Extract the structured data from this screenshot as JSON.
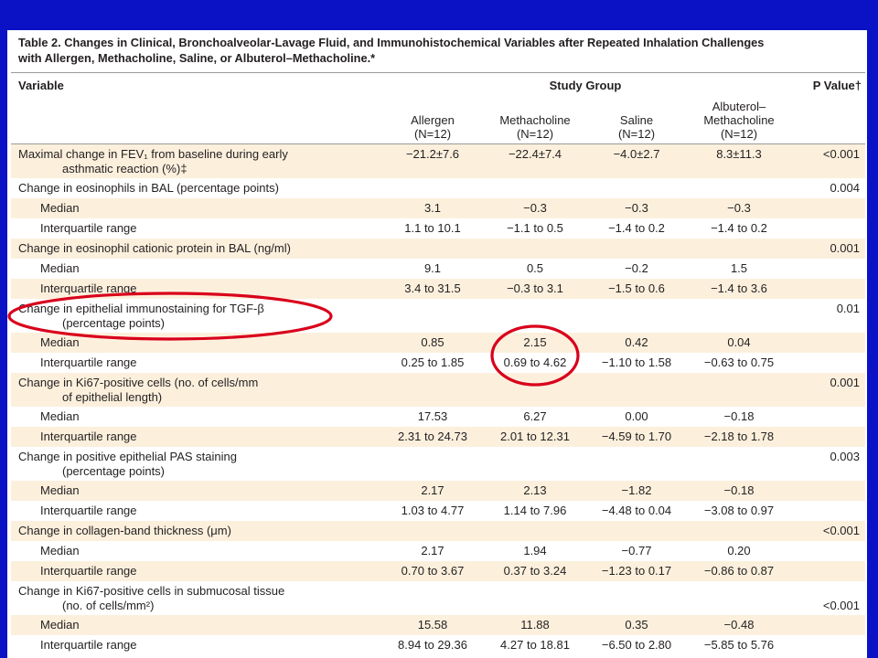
{
  "colors": {
    "slide_background": "#0b12c6",
    "panel": "#ffffff",
    "row_shade": "#fcf0dd",
    "text": "#231f20",
    "highlight": "#d9001b"
  },
  "table": {
    "title_lines": [
      "Table 2. Changes in Clinical, Bronchoalveolar-Lavage Fluid, and Immunohistochemical Variables after Repeated Inhalation Challenges",
      "with Allergen, Methacholine, Saline, or Albuterol–Methacholine.*"
    ],
    "header": {
      "variable": "Variable",
      "study_group": "Study Group",
      "p_value": "P Value†"
    },
    "groups": [
      {
        "name_lines": [
          "Allergen"
        ],
        "n": "(N=12)"
      },
      {
        "name_lines": [
          "Methacholine"
        ],
        "n": "(N=12)"
      },
      {
        "name_lines": [
          "Saline"
        ],
        "n": "(N=12)"
      },
      {
        "name_lines": [
          "Albuterol–",
          "Methacholine"
        ],
        "n": "(N=12)"
      }
    ],
    "rows": [
      {
        "label_lines": [
          "Maximal change in FEV₁ from baseline during early",
          "asthmatic reaction (%)‡"
        ],
        "values": [
          "−21.2±7.6",
          "−22.4±7.4",
          "−4.0±2.7",
          "8.3±11.3"
        ],
        "p_value": "<0.001"
      },
      {
        "label_lines": [
          "Change in eosinophils in BAL (percentage points)"
        ],
        "p_value": "0.004"
      },
      {
        "label_lines": [
          "Median"
        ],
        "values": [
          "3.1",
          "−0.3",
          "−0.3",
          "−0.3"
        ]
      },
      {
        "label_lines": [
          "Interquartile range"
        ],
        "values": [
          "1.1 to 10.1",
          "−1.1 to 0.5",
          "−1.4 to 0.2",
          "−1.4 to 0.2"
        ]
      },
      {
        "label_lines": [
          "Change in eosinophil cationic protein in BAL (ng/ml)"
        ],
        "p_value": "0.001"
      },
      {
        "label_lines": [
          "Median"
        ],
        "values": [
          "9.1",
          "0.5",
          "−0.2",
          "1.5"
        ]
      },
      {
        "label_lines": [
          "Interquartile range"
        ],
        "values": [
          "3.4 to 31.5",
          "−0.3 to 3.1",
          "−1.5 to 0.6",
          "−1.4 to 3.6"
        ]
      },
      {
        "label_lines": [
          "Change in epithelial immunostaining for TGF-β",
          "(percentage points)"
        ],
        "p_value": "0.01"
      },
      {
        "label_lines": [
          "Median"
        ],
        "values": [
          "0.85",
          "2.15",
          "0.42",
          "0.04"
        ]
      },
      {
        "label_lines": [
          "Interquartile range"
        ],
        "values": [
          "0.25 to 1.85",
          "0.69 to 4.62",
          "−1.10 to 1.58",
          "−0.63 to 0.75"
        ]
      },
      {
        "label_lines": [
          "Change in Ki67-positive cells (no. of cells/mm",
          "of epithelial length)"
        ],
        "p_value": "0.001"
      },
      {
        "label_lines": [
          "Median"
        ],
        "values": [
          "17.53",
          "6.27",
          "0.00",
          "−0.18"
        ]
      },
      {
        "label_lines": [
          "Interquartile range"
        ],
        "values": [
          "2.31 to 24.73",
          "2.01 to 12.31",
          "−4.59 to 1.70",
          "−2.18 to 1.78"
        ]
      },
      {
        "label_lines": [
          "Change in positive epithelial PAS staining",
          "(percentage points)"
        ],
        "p_value": "0.003"
      },
      {
        "label_lines": [
          "Median"
        ],
        "values": [
          "2.17",
          "2.13",
          "−1.82",
          "−0.18"
        ]
      },
      {
        "label_lines": [
          "Interquartile range"
        ],
        "values": [
          "1.03 to 4.77",
          "1.14 to 7.96",
          "−4.48 to 0.04",
          "−3.08 to 0.97"
        ]
      },
      {
        "label_lines": [
          "Change in collagen-band thickness (μm)"
        ],
        "p_value": "<0.001"
      },
      {
        "label_lines": [
          "Median"
        ],
        "values": [
          "2.17",
          "1.94",
          "−0.77",
          "0.20"
        ]
      },
      {
        "label_lines": [
          "Interquartile range"
        ],
        "values": [
          "0.70 to 3.67",
          "0.37 to 3.24",
          "−1.23 to 0.17",
          "−0.86 to 0.87"
        ]
      },
      {
        "label_lines": [
          "Change in Ki67-positive cells in submucosal tissue",
          "(no. of cells/mm²)"
        ],
        "p_value": "<0.001"
      },
      {
        "label_lines": [
          "Median"
        ],
        "values": [
          "15.58",
          "11.88",
          "0.35",
          "−0.48"
        ]
      },
      {
        "label_lines": [
          "Interquartile range"
        ],
        "values": [
          "8.94 to 29.36",
          "4.27 to 18.81",
          "−6.50 to 2.80",
          "−5.85 to 5.76"
        ]
      }
    ]
  }
}
